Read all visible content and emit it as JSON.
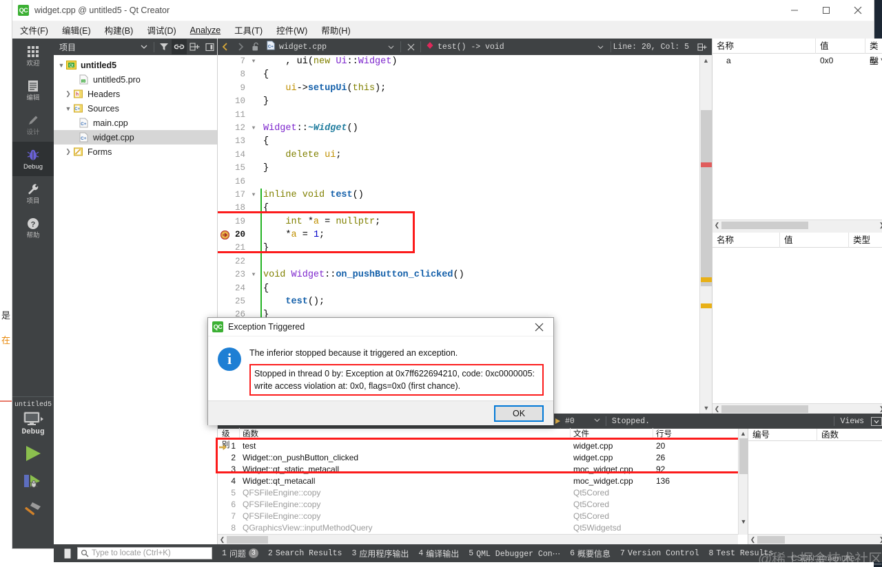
{
  "window": {
    "title": "widget.cpp @ untitled5 - Qt Creator",
    "logo_text": "QC",
    "minimize": "—",
    "maximize": "□",
    "close": "✕"
  },
  "menubar": [
    {
      "label": "文件(F)",
      "mnemonic": "F"
    },
    {
      "label": "编辑(E)",
      "mnemonic": "E"
    },
    {
      "label": "构建(B)",
      "mnemonic": "B"
    },
    {
      "label": "调试(D)",
      "mnemonic": "D"
    },
    {
      "label": "Analyze",
      "mnemonic": "A"
    },
    {
      "label": "工具(T)",
      "mnemonic": "T"
    },
    {
      "label": "控件(W)",
      "mnemonic": "W"
    },
    {
      "label": "帮助(H)",
      "mnemonic": "H"
    }
  ],
  "modebar": {
    "modes": [
      {
        "label": "欢迎",
        "icon": "grid-icon",
        "active": false
      },
      {
        "label": "编辑",
        "icon": "document-icon",
        "active": false
      },
      {
        "label": "设计",
        "icon": "pencil-icon",
        "active": false
      },
      {
        "label": "Debug",
        "icon": "bug-icon",
        "active": true
      },
      {
        "label": "项目",
        "icon": "wrench-icon",
        "active": false
      },
      {
        "label": "帮助",
        "icon": "question-icon",
        "active": false
      }
    ],
    "kit": {
      "project": "untitled5",
      "build_config": "Debug",
      "icon": "monitor-icon",
      "run_icon": "run-play-icon",
      "debug_icon": "start-debug-icon",
      "build_icon": "hammer-icon"
    }
  },
  "project_panel": {
    "title": "项目",
    "toolbar_icons": [
      "filter-icon",
      "link-icon",
      "split-add-icon",
      "close-sidebar-icon"
    ],
    "tree": [
      {
        "label": "untitled5",
        "indent": 0,
        "arrow": "down",
        "icon": "qt-project-icon",
        "bold": true,
        "selected": false
      },
      {
        "label": "untitled5.pro",
        "indent": 1,
        "arrow": "none",
        "icon": "pro-file-icon",
        "bold": false,
        "selected": false
      },
      {
        "label": "Headers",
        "indent": 1,
        "arrow": "right",
        "icon": "headers-folder-icon",
        "bold": false,
        "selected": false
      },
      {
        "label": "Sources",
        "indent": 1,
        "arrow": "down",
        "icon": "sources-folder-icon",
        "bold": false,
        "selected": false
      },
      {
        "label": "main.cpp",
        "indent": 2,
        "arrow": "none",
        "icon": "cpp-file-icon",
        "bold": false,
        "selected": false
      },
      {
        "label": "widget.cpp",
        "indent": 2,
        "arrow": "none",
        "icon": "cpp-file-icon",
        "bold": false,
        "selected": true
      },
      {
        "label": "Forms",
        "indent": 1,
        "arrow": "right",
        "icon": "forms-folder-icon",
        "bold": false,
        "selected": false
      }
    ]
  },
  "editor": {
    "toolbar": {
      "back_icon": "nav-back-icon",
      "forward_icon": "nav-forward-icon",
      "lock_icon": "unlocked-icon",
      "file_icon": "cpp-file-icon",
      "filename": "widget.cpp",
      "close_icon": "close-document-icon",
      "symbol_icon": "function-symbol-icon",
      "symbol": "test() -> void",
      "position": "Line: 20, Col: 5",
      "split_icon": "split-editor-icon"
    },
    "lines": [
      {
        "n": 7,
        "fold": "down",
        "changed": false,
        "marker": "none",
        "tokens": [
          {
            "t": "    , ",
            "c": "pl"
          },
          {
            "t": "ui",
            "c": "pl"
          },
          {
            "t": "(",
            "c": "pl"
          },
          {
            "t": "new",
            "c": "k"
          },
          {
            "t": " ",
            "c": "pl"
          },
          {
            "t": "Ui",
            "c": "kw"
          },
          {
            "t": "::",
            "c": "pl"
          },
          {
            "t": "Widget",
            "c": "kw"
          },
          {
            "t": ")",
            "c": "pl"
          }
        ]
      },
      {
        "n": 8,
        "fold": "none",
        "changed": false,
        "marker": "none",
        "tokens": [
          {
            "t": "{",
            "c": "pl"
          }
        ]
      },
      {
        "n": 9,
        "fold": "none",
        "changed": false,
        "marker": "none",
        "tokens": [
          {
            "t": "    ",
            "c": "pl"
          },
          {
            "t": "ui",
            "c": "vr"
          },
          {
            "t": "->",
            "c": "pl"
          },
          {
            "t": "setupUi",
            "c": "fn"
          },
          {
            "t": "(",
            "c": "pl"
          },
          {
            "t": "this",
            "c": "k"
          },
          {
            "t": ");",
            "c": "pl"
          }
        ]
      },
      {
        "n": 10,
        "fold": "none",
        "changed": false,
        "marker": "none",
        "tokens": [
          {
            "t": "}",
            "c": "pl"
          }
        ]
      },
      {
        "n": 11,
        "fold": "none",
        "changed": false,
        "marker": "none",
        "tokens": []
      },
      {
        "n": 12,
        "fold": "down",
        "changed": false,
        "marker": "none",
        "tokens": [
          {
            "t": "Widget",
            "c": "kw"
          },
          {
            "t": "::",
            "c": "pl"
          },
          {
            "t": "~Widget",
            "c": "fni"
          },
          {
            "t": "()",
            "c": "pl"
          }
        ]
      },
      {
        "n": 13,
        "fold": "none",
        "changed": false,
        "marker": "none",
        "tokens": [
          {
            "t": "{",
            "c": "pl"
          }
        ]
      },
      {
        "n": 14,
        "fold": "none",
        "changed": false,
        "marker": "none",
        "tokens": [
          {
            "t": "    ",
            "c": "pl"
          },
          {
            "t": "delete",
            "c": "k"
          },
          {
            "t": " ",
            "c": "pl"
          },
          {
            "t": "ui",
            "c": "vr"
          },
          {
            "t": ";",
            "c": "pl"
          }
        ]
      },
      {
        "n": 15,
        "fold": "none",
        "changed": false,
        "marker": "none",
        "tokens": [
          {
            "t": "}",
            "c": "pl"
          }
        ]
      },
      {
        "n": 16,
        "fold": "none",
        "changed": false,
        "marker": "none",
        "tokens": []
      },
      {
        "n": 17,
        "fold": "down",
        "changed": true,
        "marker": "none",
        "tokens": [
          {
            "t": "inline",
            "c": "k"
          },
          {
            "t": " ",
            "c": "pl"
          },
          {
            "t": "void",
            "c": "k"
          },
          {
            "t": " ",
            "c": "pl"
          },
          {
            "t": "test",
            "c": "fn"
          },
          {
            "t": "()",
            "c": "pl"
          }
        ]
      },
      {
        "n": 18,
        "fold": "none",
        "changed": true,
        "marker": "none",
        "tokens": [
          {
            "t": "{",
            "c": "pl"
          }
        ]
      },
      {
        "n": 19,
        "fold": "none",
        "changed": true,
        "marker": "none",
        "tokens": [
          {
            "t": "    ",
            "c": "pl"
          },
          {
            "t": "int",
            "c": "k"
          },
          {
            "t": " *",
            "c": "pl"
          },
          {
            "t": "a",
            "c": "vr"
          },
          {
            "t": " = ",
            "c": "pl"
          },
          {
            "t": "nullptr",
            "c": "k"
          },
          {
            "t": ";",
            "c": "pl"
          }
        ]
      },
      {
        "n": 20,
        "fold": "none",
        "changed": true,
        "marker": "current-line-arrow",
        "tokens": [
          {
            "t": "    *",
            "c": "pl"
          },
          {
            "t": "a",
            "c": "vr"
          },
          {
            "t": " = ",
            "c": "pl"
          },
          {
            "t": "1",
            "c": "num"
          },
          {
            "t": ";",
            "c": "pl"
          }
        ]
      },
      {
        "n": 21,
        "fold": "none",
        "changed": true,
        "marker": "none",
        "tokens": [
          {
            "t": "}",
            "c": "pl"
          }
        ]
      },
      {
        "n": 22,
        "fold": "none",
        "changed": true,
        "marker": "none",
        "tokens": []
      },
      {
        "n": 23,
        "fold": "down",
        "changed": true,
        "marker": "none",
        "tokens": [
          {
            "t": "void",
            "c": "k"
          },
          {
            "t": " ",
            "c": "pl"
          },
          {
            "t": "Widget",
            "c": "kw"
          },
          {
            "t": "::",
            "c": "pl"
          },
          {
            "t": "on_pushButton_clicked",
            "c": "fn"
          },
          {
            "t": "()",
            "c": "pl"
          }
        ]
      },
      {
        "n": 24,
        "fold": "none",
        "changed": true,
        "marker": "none",
        "tokens": [
          {
            "t": "{",
            "c": "pl"
          }
        ]
      },
      {
        "n": 25,
        "fold": "none",
        "changed": true,
        "marker": "none",
        "tokens": [
          {
            "t": "    ",
            "c": "pl"
          },
          {
            "t": "test",
            "c": "fn"
          },
          {
            "t": "();",
            "c": "pl"
          }
        ]
      },
      {
        "n": 26,
        "fold": "none",
        "changed": true,
        "marker": "none",
        "tokens": [
          {
            "t": "}",
            "c": "pl"
          }
        ]
      }
    ],
    "highlight_color": "#fc1b1b"
  },
  "locals_panel": {
    "headers": [
      "名称",
      "值",
      "类型"
    ],
    "rows": [
      {
        "name": "a",
        "value": "0x0",
        "type": "int *"
      }
    ]
  },
  "expressions_panel": {
    "headers": [
      "名称",
      "值",
      "类型"
    ],
    "rows": []
  },
  "debug_toolbar": {
    "thread_icon": "current-thread-icon",
    "thread": "#0",
    "status": "Stopped.",
    "views_label": "Views",
    "views_icon": "views-menu-icon"
  },
  "stack_panel": {
    "headers": [
      "级别",
      "函数",
      "文件",
      "行号"
    ],
    "rows": [
      {
        "level": "1",
        "func": "test",
        "file": "widget.cpp",
        "line": "20",
        "current": true,
        "dim": false
      },
      {
        "level": "2",
        "func": "Widget::on_pushButton_clicked",
        "file": "widget.cpp",
        "line": "26",
        "current": false,
        "dim": false
      },
      {
        "level": "3",
        "func": "Widget::qt_static_metacall",
        "file": "moc_widget.cpp",
        "line": "92",
        "current": false,
        "dim": false
      },
      {
        "level": "4",
        "func": "Widget::qt_metacall",
        "file": "moc_widget.cpp",
        "line": "136",
        "current": false,
        "dim": false
      },
      {
        "level": "5",
        "func": "QFSFileEngine::copy",
        "file": "Qt5Cored",
        "line": "",
        "current": false,
        "dim": true
      },
      {
        "level": "6",
        "func": "QFSFileEngine::copy",
        "file": "Qt5Cored",
        "line": "",
        "current": false,
        "dim": true
      },
      {
        "level": "7",
        "func": "QFSFileEngine::copy",
        "file": "Qt5Cored",
        "line": "",
        "current": false,
        "dim": true
      },
      {
        "level": "8",
        "func": "QGraphicsView::inputMethodQuery",
        "file": "Qt5Widgetsd",
        "line": "",
        "current": false,
        "dim": true
      }
    ]
  },
  "breakpoints_panel": {
    "headers": [
      "编号",
      "函数"
    ],
    "rows": []
  },
  "dialog": {
    "logo_text": "QC",
    "title": "Exception Triggered",
    "close_icon": "close-icon",
    "info_icon": "info-icon",
    "message": "The inferior stopped because it triggered an exception.",
    "detail_line1": "Stopped in thread 0 by: Exception at 0x7ff622694210, code: 0xc0000005:",
    "detail_line2": "write access violation at: 0x0, flags=0x0 (first chance).",
    "ok_label": "OK",
    "accent_color": "#0078d7",
    "highlight_color": "#fc1b1b"
  },
  "statusbar": {
    "toggle_icon": "toggle-sidebar-icon",
    "search_icon": "search-icon",
    "locator_placeholder": "Type to locate (Ctrl+K)",
    "panes": [
      {
        "num": "1",
        "label": "问题",
        "badge": "3",
        "cn": true
      },
      {
        "num": "2",
        "label": "Search Results",
        "badge": "",
        "cn": false
      },
      {
        "num": "3",
        "label": "应用程序输出",
        "badge": "",
        "cn": true
      },
      {
        "num": "4",
        "label": "编译输出",
        "badge": "",
        "cn": true
      },
      {
        "num": "5",
        "label": "QML Debugger Con⋯",
        "badge": "",
        "cn": false
      },
      {
        "num": "6",
        "label": "概要信息",
        "badge": "",
        "cn": true
      },
      {
        "num": "7",
        "label": "Version Control",
        "badge": "",
        "cn": false
      },
      {
        "num": "8",
        "label": "Test Results",
        "badge": "",
        "cn": false
      }
    ]
  },
  "background": {
    "left_fragments": [
      "是",
      "在"
    ],
    "watermark_main": "@稀土掘金技术社区",
    "watermark_sub": "CSDN @manuhe"
  }
}
